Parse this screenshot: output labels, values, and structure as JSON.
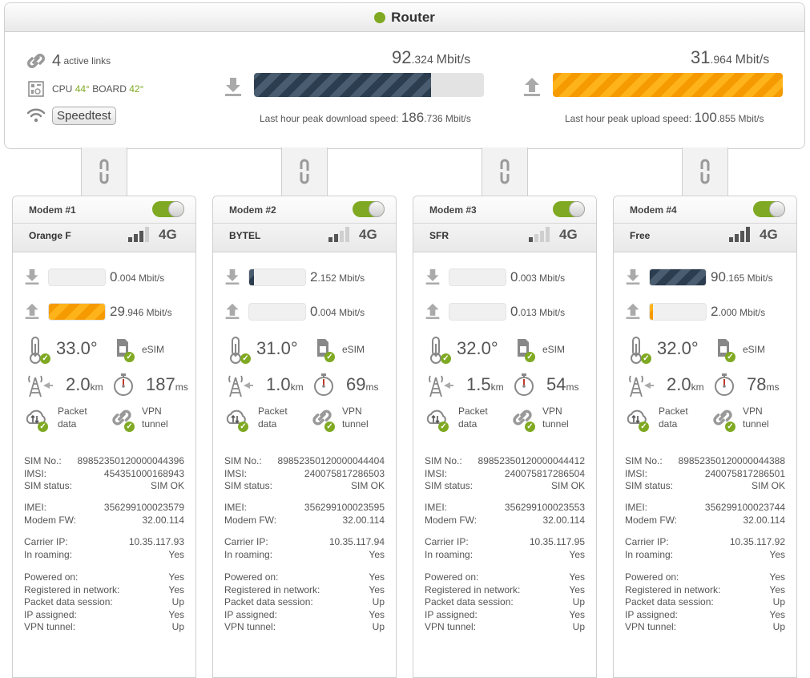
{
  "router": {
    "title": "Router",
    "active_links": {
      "count": "4",
      "label": "active links"
    },
    "cpu": {
      "label": "CPU",
      "cpu_temp": "44°",
      "board_label": "BOARD",
      "board_temp": "42°"
    },
    "speedtest_label": "Speedtest",
    "download": {
      "int": "92",
      "dec": ".324",
      "unit": "Mbit/s",
      "fill_percent": 77,
      "peak_label": "Last hour peak download speed:",
      "peak_int": "186",
      "peak_dec": ".736",
      "peak_unit": "Mbit/s"
    },
    "upload": {
      "int": "31",
      "dec": ".964",
      "unit": "Mbit/s",
      "fill_percent": 100,
      "peak_label": "Last hour peak upload speed:",
      "peak_int": "100",
      "peak_dec": ".855",
      "peak_unit": "Mbit/s"
    }
  },
  "labels": {
    "esim": "eSIM",
    "packet": "Packet",
    "data": "data",
    "vpn": "VPN",
    "tunnel": "tunnel",
    "km": "km",
    "ms": "ms",
    "mbits": "Mbit/s",
    "sim_no": "SIM No.:",
    "imsi": "IMSI:",
    "sim_status": "SIM status:",
    "imei": "IMEI:",
    "modem_fw": "Modem FW:",
    "carrier_ip": "Carrier IP:",
    "in_roaming": "In roaming:",
    "powered_on": "Powered on:",
    "registered": "Registered in network:",
    "pds": "Packet data session:",
    "ip_assigned": "IP assigned:",
    "vpn_tunnel": "VPN tunnel:"
  },
  "colors": {
    "accent_green": "#7fa922",
    "download_navy": "#2b3d4f",
    "upload_orange": "#f59a00"
  },
  "modems": [
    {
      "title": "Modem #1",
      "carrier": "Orange F",
      "network": "4G",
      "signal_bars": 3,
      "enabled": true,
      "dl_int": "0",
      "dl_dec": ".004",
      "dl_fill": 0,
      "ul_int": "29",
      "ul_dec": ".946",
      "ul_fill": 100,
      "temp": "33.0°",
      "dist": "2.0",
      "lat": "187",
      "sim_no": "89852350120000044396",
      "imsi": "454351000168943",
      "sim_status": "SIM OK",
      "imei": "356299100023579",
      "fw": "32.00.114",
      "carrier_ip": "10.35.117.93",
      "roaming": "Yes",
      "powered": "Yes",
      "registered": "Yes",
      "pds": "Up",
      "ip_assigned": "Yes",
      "vpn": "Up"
    },
    {
      "title": "Modem #2",
      "carrier": "BYTEL",
      "network": "4G",
      "signal_bars": 2,
      "enabled": true,
      "dl_int": "2",
      "dl_dec": ".152",
      "dl_fill": 8,
      "ul_int": "0",
      "ul_dec": ".004",
      "ul_fill": 0,
      "temp": "31.0°",
      "dist": "1.0",
      "lat": "69",
      "sim_no": "89852350120000044404",
      "imsi": "240075817286503",
      "sim_status": "SIM OK",
      "imei": "356299100023595",
      "fw": "32.00.114",
      "carrier_ip": "10.35.117.94",
      "roaming": "Yes",
      "powered": "Yes",
      "registered": "Yes",
      "pds": "Up",
      "ip_assigned": "Yes",
      "vpn": "Up"
    },
    {
      "title": "Modem #3",
      "carrier": "SFR",
      "network": "4G",
      "signal_bars": 1,
      "enabled": true,
      "dl_int": "0",
      "dl_dec": ".003",
      "dl_fill": 0,
      "ul_int": "0",
      "ul_dec": ".013",
      "ul_fill": 0,
      "temp": "32.0°",
      "dist": "1.5",
      "lat": "54",
      "sim_no": "89852350120000044412",
      "imsi": "240075817286504",
      "sim_status": "SIM OK",
      "imei": "356299100023553",
      "fw": "32.00.114",
      "carrier_ip": "10.35.117.95",
      "roaming": "Yes",
      "powered": "Yes",
      "registered": "Yes",
      "pds": "Up",
      "ip_assigned": "Yes",
      "vpn": "Up"
    },
    {
      "title": "Modem #4",
      "carrier": "Free",
      "network": "4G",
      "signal_bars": 4,
      "enabled": true,
      "dl_int": "90",
      "dl_dec": ".165",
      "dl_fill": 100,
      "ul_int": "2",
      "ul_dec": ".000",
      "ul_fill": 5,
      "temp": "32.0°",
      "dist": "2.0",
      "lat": "78",
      "sim_no": "89852350120000044388",
      "imsi": "240075817286501",
      "sim_status": "SIM OK",
      "imei": "356299100023744",
      "fw": "32.00.114",
      "carrier_ip": "10.35.117.92",
      "roaming": "Yes",
      "powered": "Yes",
      "registered": "Yes",
      "pds": "Up",
      "ip_assigned": "Yes",
      "vpn": "Up"
    }
  ]
}
